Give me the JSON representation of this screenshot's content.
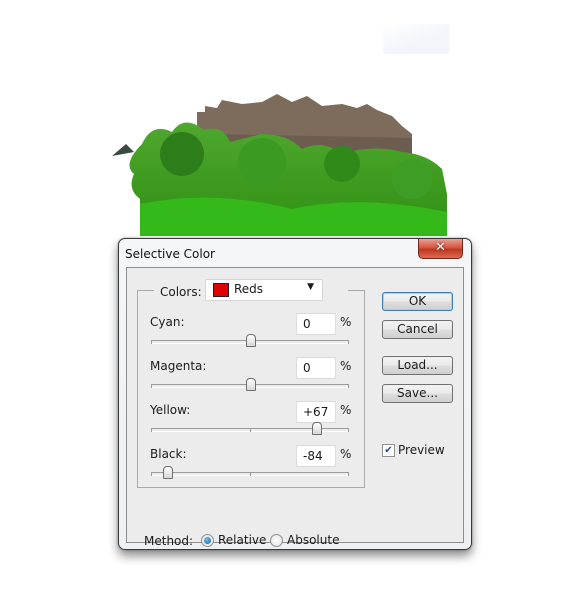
{
  "background": {
    "photo": "castle-on-green-hill-image",
    "photo_colors": {
      "sky": "#ffffff",
      "stone": "#7a6a5c",
      "trees": "#3f9e2a",
      "grass": "#36b51d"
    }
  },
  "dialog": {
    "title": "Selective Color",
    "close_label": "✕",
    "colors": {
      "label": "Colors:",
      "selected": "Reds",
      "swatch_color": "#e00000"
    },
    "sliders": [
      {
        "name": "cyan",
        "label": "Cyan:",
        "value": "0",
        "numeric": 0,
        "unit": "%"
      },
      {
        "name": "magenta",
        "label": "Magenta:",
        "value": "0",
        "numeric": 0,
        "unit": "%"
      },
      {
        "name": "yellow",
        "label": "Yellow:",
        "value": "+67",
        "numeric": 67,
        "unit": "%"
      },
      {
        "name": "black",
        "label": "Black:",
        "value": "-84",
        "numeric": -84,
        "unit": "%"
      }
    ],
    "slider_range": [
      -100,
      100
    ],
    "buttons": {
      "ok": "OK",
      "cancel": "Cancel",
      "load": "Load...",
      "save": "Save..."
    },
    "preview": {
      "label": "Preview",
      "checked": true
    },
    "method": {
      "label": "Method:",
      "options": [
        {
          "label": "Relative",
          "selected": true
        },
        {
          "label": "Absolute",
          "selected": false
        }
      ]
    }
  }
}
